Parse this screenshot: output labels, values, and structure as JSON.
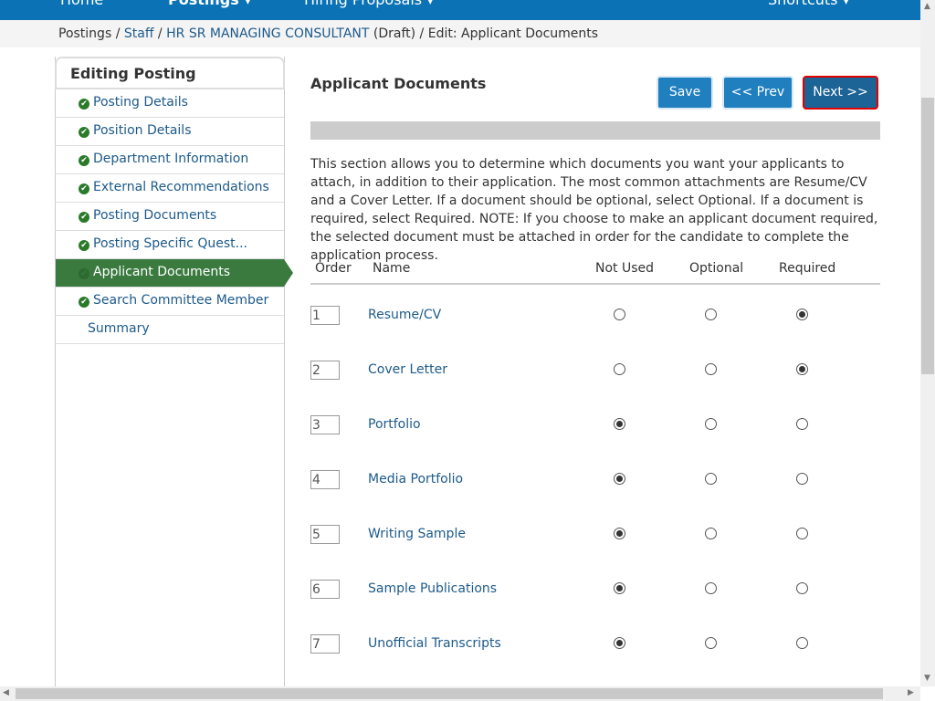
{
  "nav": {
    "items": [
      "Home",
      "Postings ▾",
      "Hiring Proposals ▾",
      "Shortcuts ▾"
    ]
  },
  "breadcrumb": {
    "root": "Postings",
    "staff": "Staff",
    "posting": "HR SR MANAGING CONSULTANT",
    "status": "(Draft)",
    "current": "Edit: Applicant Documents"
  },
  "sidebar": {
    "title": "Editing Posting",
    "items": [
      {
        "label": "Posting Details",
        "done": true
      },
      {
        "label": "Position Details",
        "done": true
      },
      {
        "label": "Department Information",
        "done": true
      },
      {
        "label": "External Recommendations",
        "done": true
      },
      {
        "label": "Posting Documents",
        "done": true
      },
      {
        "label": "Posting Specific Quest...",
        "done": true
      },
      {
        "label": "Applicant Documents",
        "done": true,
        "active": true
      },
      {
        "label": "Search Committee Member",
        "done": true
      },
      {
        "label": "Summary",
        "done": false
      }
    ]
  },
  "main": {
    "title": "Applicant Documents",
    "save": "Save",
    "prev": "<< Prev",
    "next": "Next >>",
    "description": "This section allows you to determine which documents you want your applicants to attach, in addition to their application. The most common attachments are Resume/CV and a Cover Letter. If a document should be optional, select Optional. If a document is required, select Required. NOTE: If you choose to make an applicant document required, the selected document must be attached in order for the candidate to complete the application process.",
    "columns": [
      "Order",
      "Name",
      "Not Used",
      "Optional",
      "Required"
    ],
    "rows": [
      {
        "order": "1",
        "name": "Resume/CV",
        "selected": "Required"
      },
      {
        "order": "2",
        "name": "Cover Letter",
        "selected": "Required"
      },
      {
        "order": "3",
        "name": "Portfolio",
        "selected": "Not Used"
      },
      {
        "order": "4",
        "name": "Media Portfolio",
        "selected": "Not Used"
      },
      {
        "order": "5",
        "name": "Writing Sample",
        "selected": "Not Used"
      },
      {
        "order": "6",
        "name": "Sample Publications",
        "selected": "Not Used"
      },
      {
        "order": "7",
        "name": "Unofficial Transcripts",
        "selected": "Not Used"
      }
    ]
  }
}
